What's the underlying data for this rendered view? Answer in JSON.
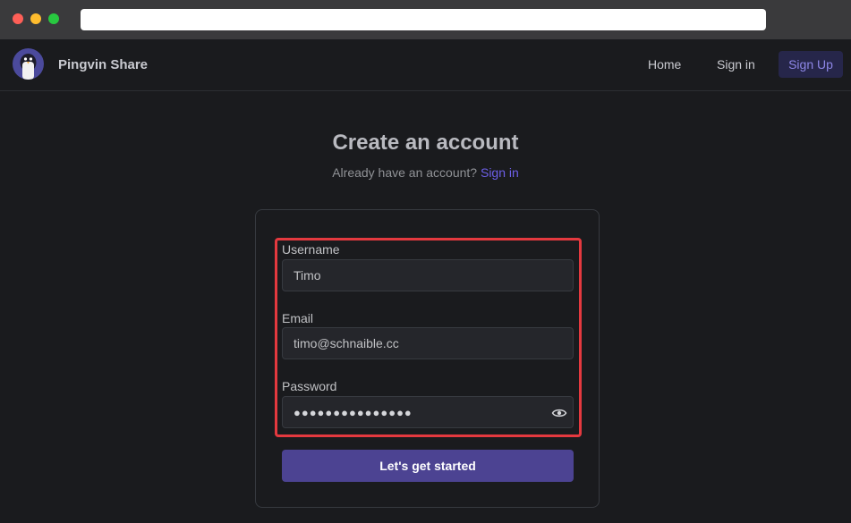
{
  "app": {
    "brand": "Pingvin Share"
  },
  "nav": {
    "home": "Home",
    "sign_in": "Sign in",
    "sign_up": "Sign Up"
  },
  "page": {
    "title": "Create an account",
    "subtitle_text": "Already have an account?",
    "subtitle_link": "Sign in"
  },
  "form": {
    "username_label": "Username",
    "username_value": "Timo",
    "email_label": "Email",
    "email_value": "timo@schnaible.cc",
    "password_label": "Password",
    "password_masked": "●●●●●●●●●●●●●●●",
    "submit_label": "Let's get started"
  },
  "icons": {
    "logo": "penguin-logo-icon",
    "password_toggle": "eye-icon"
  },
  "colors": {
    "background": "#1a1b1e",
    "accent": "#6d5fe8",
    "button": "#4c4392",
    "highlight": "#e4393f"
  }
}
